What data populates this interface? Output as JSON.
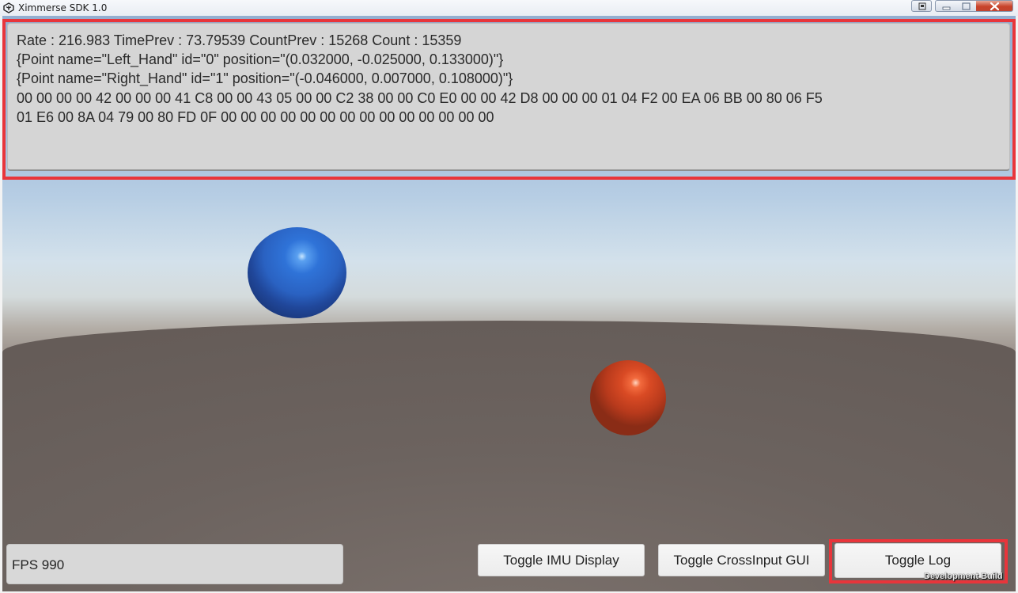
{
  "window": {
    "title": "Ximmerse SDK 1.0"
  },
  "log": {
    "lines": [
      "Rate : 216.983 TimePrev : 73.79539 CountPrev : 15268 Count : 15359",
      "{Point name=\"Left_Hand\" id=\"0\" position=\"(0.032000, -0.025000, 0.133000)\"}",
      "{Point name=\"Right_Hand\" id=\"1\" position=\"(-0.046000, 0.007000, 0.108000)\"}",
      "00 00 00 00 42 00 00 00 41 C8 00 00 43 05 00 00 C2 38 00 00 C0 E0 00 00 42 D8 00 00 00 01 04 F2 00 EA 06 BB 00 80 06 F5",
      "01 E6 00 8A 04 79 00 80 FD 0F 00 00 00 00 00 00 00 00 00 00 00 00 00 00"
    ]
  },
  "fps": {
    "label": "FPS 990"
  },
  "buttons": {
    "imu": "Toggle IMU Display",
    "crossinput": "Toggle CrossInput GUI",
    "log": "Toggle Log"
  },
  "watermark": "Development Build",
  "colors": {
    "highlight": "#e8353b",
    "sphere_left": "#2f6fd6",
    "sphere_right": "#c8421f"
  },
  "icons": {
    "app": "unity-logo-icon",
    "extra": "restore-icon",
    "minimize": "minimize-icon",
    "maximize": "maximize-icon",
    "close": "close-icon"
  }
}
